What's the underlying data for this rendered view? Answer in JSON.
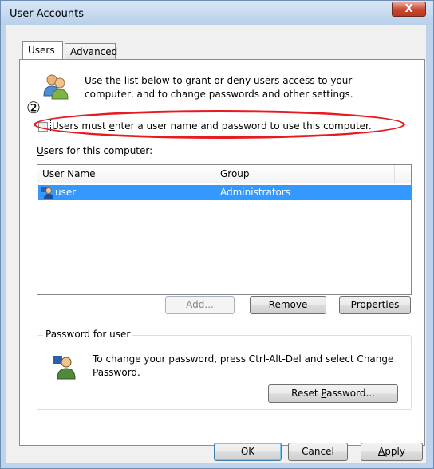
{
  "window": {
    "title": "User Accounts",
    "close_label": "X"
  },
  "tabs": [
    {
      "label": "Users",
      "selected": true
    },
    {
      "label": "Advanced",
      "selected": false
    }
  ],
  "intro": {
    "text": "Use the list below to grant or deny users access to your computer, and to change passwords and other settings.",
    "icon": "users-icon"
  },
  "annotation": {
    "marker": "②",
    "highlight_color": "#e8191f"
  },
  "login_checkbox": {
    "label_pre": "Users must ",
    "label_accel": "e",
    "label_post": "nter a user name and password to use this computer.",
    "checked": false
  },
  "users_list": {
    "label_accel": "U",
    "label_rest": "sers for this computer:",
    "columns": [
      "User Name",
      "Group"
    ],
    "rows": [
      {
        "name": "user",
        "group": "Administrators",
        "selected": true,
        "icon": "admin-user-icon"
      }
    ]
  },
  "list_buttons": {
    "add_pre": "A",
    "add_accel": "d",
    "add_post": "d...",
    "remove_accel": "R",
    "remove_rest": "emove",
    "props_pre": "Pr",
    "props_accel": "o",
    "props_post": "perties"
  },
  "password_group": {
    "legend": "Password for user",
    "text": "To change your password, press Ctrl-Alt-Del and select Change Password.",
    "icon": "password-user-icon",
    "reset_pre": "Reset ",
    "reset_accel": "P",
    "reset_post": "assword..."
  },
  "dialog_buttons": {
    "ok": "OK",
    "cancel": "Cancel",
    "apply_accel": "A",
    "apply_rest": "pply"
  },
  "colors": {
    "selection": "#3399ff",
    "frame": "#bfd4ea"
  }
}
